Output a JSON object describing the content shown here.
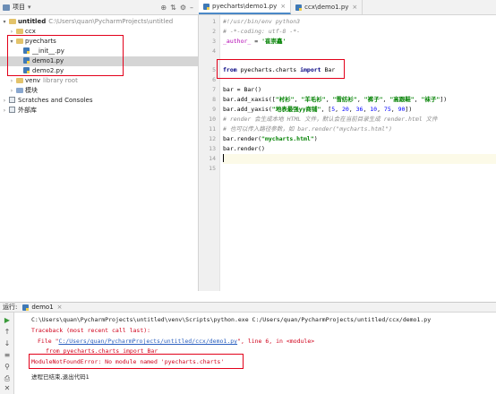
{
  "project_panel": {
    "title": "项目",
    "tree": [
      {
        "label": "untitled",
        "path": "C:\\Users\\quan\\PycharmProjects\\untitled"
      },
      {
        "label": "ccx"
      },
      {
        "label": "pyecharts"
      },
      {
        "label": "__init__.py"
      },
      {
        "label": "demo1.py"
      },
      {
        "label": "demo2.py"
      },
      {
        "label": "venv",
        "path": "library root"
      },
      {
        "label": "模块"
      },
      {
        "label": "Scratches and Consoles"
      },
      {
        "label": "外部库"
      }
    ]
  },
  "editor": {
    "tabs": [
      {
        "label": "pyecharts\\demo1.py"
      },
      {
        "label": "ccx\\demo1.py"
      }
    ],
    "line_numbers": [
      "1",
      "2",
      "3",
      "4",
      "5",
      "6",
      "7",
      "8",
      "9",
      "10",
      "11",
      "12",
      "13",
      "14",
      "15"
    ],
    "lines": [
      {
        "text": "#!/usr/bin/env python3"
      },
      {
        "text": "# -*-coding: utf-8 -*-"
      },
      {
        "text": "_author_ = '崔崇鑫'"
      },
      {
        "text": ""
      },
      {
        "text": "from pyecharts.charts import Bar"
      },
      {
        "text": ""
      },
      {
        "text": "bar = Bar()"
      },
      {
        "text": "bar.add_xaxis([\"衬衫\", \"羊毛衫\", \"雪纺衫\", \"裤子\", \"高跟鞋\", \"袜子\"])"
      },
      {
        "text": "bar.add_yaxis(\"地表最强yy商铺\", [5, 20, 36, 10, 75, 90])"
      },
      {
        "text": "# render 会生成本地 HTML 文件，默认会在当前目录生成 render.html 文件"
      },
      {
        "text": "# 也可以传入路径参数，如 bar.render(\"mycharts.html\")"
      },
      {
        "text": "bar.render(\"mycharts.html\")"
      },
      {
        "text": "bar.render()"
      },
      {
        "text": ""
      },
      {
        "text": ""
      }
    ]
  },
  "run_panel": {
    "label": "运行:",
    "tab": "demo1",
    "output": {
      "cmd": "C:\\Users\\quan\\PycharmProjects\\untitled\\venv\\Scripts\\python.exe C:/Users/quan/PycharmProjects/untitled/ccx/demo1.py",
      "traceback": "Traceback (most recent call last):",
      "file_prefix": "File \"",
      "file_link": "C:/Users/quan/PycharmProjects/untitled/ccx/demo1.py",
      "file_suffix": "\", line 6, in <module>",
      "source": "from pyecharts.charts import Bar",
      "error": "ModuleNotFoundError: No module named 'pyecharts.charts'",
      "exit": "进程已结束,退出代码1"
    }
  },
  "colors": {
    "highlight_box": "#e2001a",
    "error_text": "#d0021b",
    "keyword": "#000080",
    "string": "#008000",
    "comment": "#8c8c8c"
  }
}
